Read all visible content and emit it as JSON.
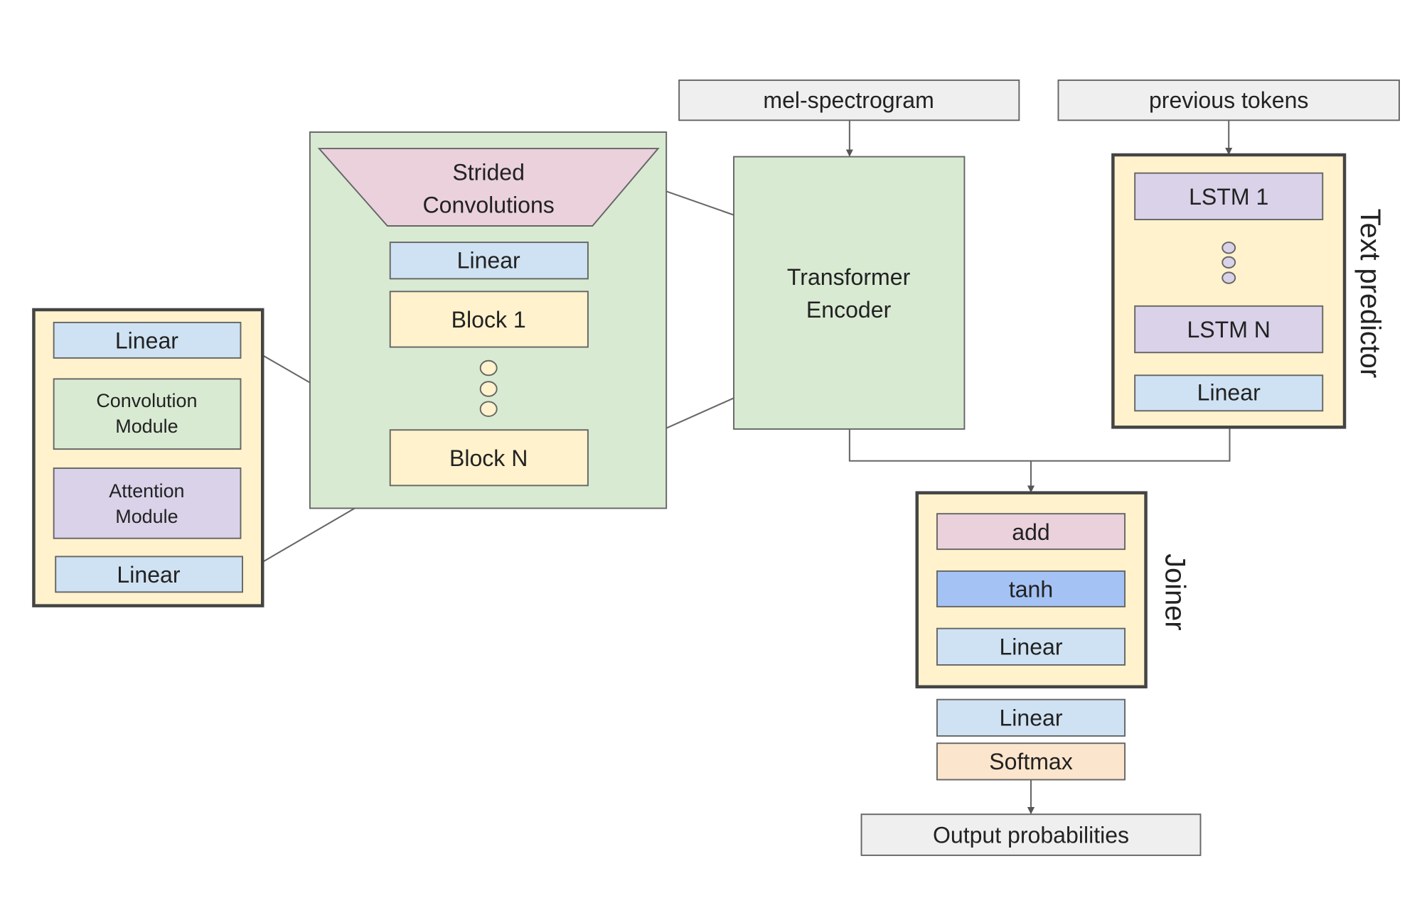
{
  "colors": {
    "linear": "#cfe2f3",
    "block": "#fff2cc",
    "encoder_green": "#d9ead3",
    "strided_pink": "#ead1dc",
    "lstm_purple": "#d9d2e9",
    "tanh_blue": "#a4c2f4",
    "softmax_orange": "#fce5cd",
    "io_gray": "#efefef",
    "border": "#666666"
  },
  "inputs": {
    "mel": "mel-spectrogram",
    "tokens": "previous tokens"
  },
  "conformer_block": {
    "layers": [
      "Linear",
      "Convolution|Module",
      "Attention|Module",
      "Linear"
    ],
    "conv_l1": "Convolution",
    "conv_l2": "Module",
    "att_l1": "Attention",
    "att_l2": "Module",
    "linear_top": "Linear",
    "linear_bottom": "Linear"
  },
  "encoder_stack": {
    "strided_l1": "Strided",
    "strided_l2": "Convolutions",
    "linear": "Linear",
    "block_1": "Block 1",
    "block_n": "Block N"
  },
  "transformer": {
    "l1": "Transformer",
    "l2": "Encoder"
  },
  "text_predictor": {
    "label": "Text predictor",
    "lstm_1": "LSTM 1",
    "lstm_n": "LSTM N",
    "linear": "Linear"
  },
  "joiner": {
    "label": "Joiner",
    "add": "add",
    "tanh": "tanh",
    "linear": "Linear"
  },
  "head": {
    "linear": "Linear",
    "softmax": "Softmax"
  },
  "output": "Output probabilities"
}
